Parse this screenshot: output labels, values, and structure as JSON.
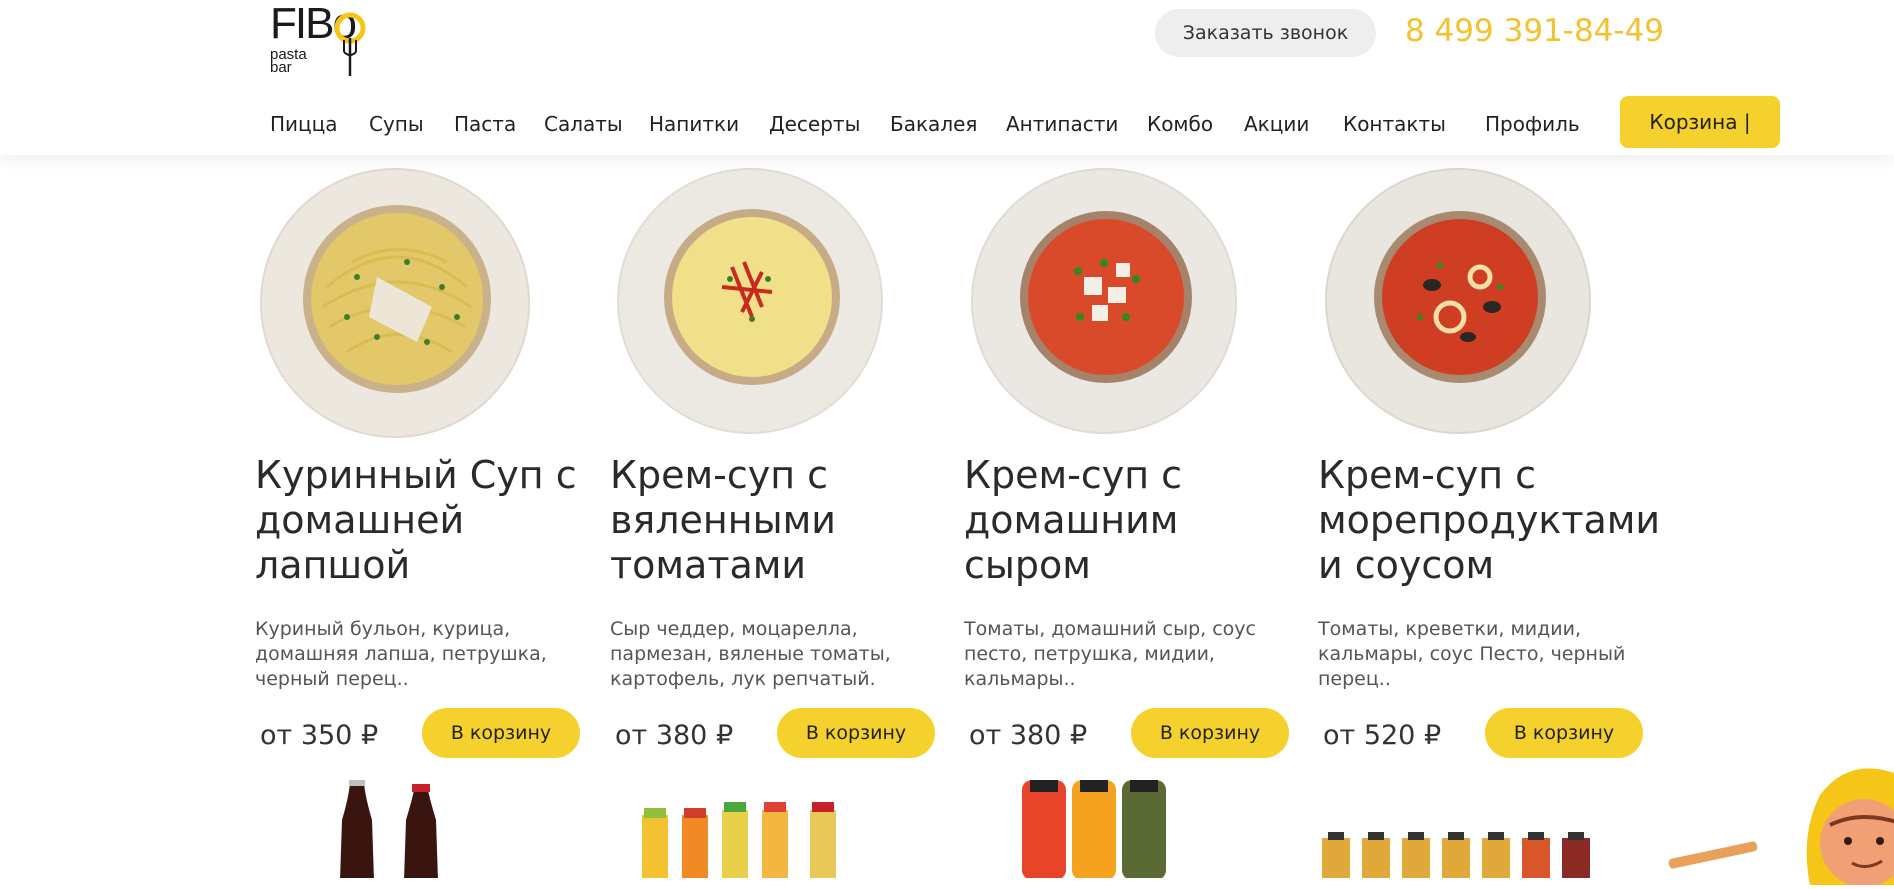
{
  "brand": {
    "logo_main": "FIBo",
    "logo_sub_1": "pasta",
    "logo_sub_2": "bar",
    "accent_color": "#f5d12d",
    "phone_color": "#f2c230"
  },
  "header": {
    "callback_label": "Заказать звонок",
    "phone": "8 499 391-84-49"
  },
  "nav": {
    "items": [
      "Пицца",
      "Супы",
      "Паста",
      "Салаты",
      "Напитки",
      "Десерты",
      "Бакалея",
      "Антипасти",
      "Комбо",
      "Акции",
      "Контакты",
      "Профиль"
    ],
    "cart_label": "Корзина |"
  },
  "products": [
    {
      "title": "Куринный Суп с домашней лапшой",
      "description": "Куриный бульон, курица, домашняя лапша, петрушка, черный перец..",
      "price": "от 350 ₽",
      "button": "В корзину",
      "image": "chicken-noodle-soup-plate"
    },
    {
      "title": "Крем-суп с вяленными томатами",
      "description": "Сыр чеддер, моцарелла, пармезан, вяленые томаты, картофель, лук репчатый.",
      "price": "от 380 ₽",
      "button": "В корзину",
      "image": "cream-soup-sundried-tomato-plate"
    },
    {
      "title": "Крем-суп с домашним сыром",
      "description": "Томаты, домашний сыр, соус песто, петрушка, мидии, кальмары..",
      "price": "от 380 ₽",
      "button": "В корзину",
      "image": "tomato-cheese-soup-plate"
    },
    {
      "title": "Крем-суп с морепродуктами и соусом",
      "description": "Томаты, креветки, мидии, кальмары, соус Песто, черный перец..",
      "price": "от 520 ₽",
      "button": "В корзину",
      "image": "seafood-soup-plate"
    }
  ],
  "drinks_row": [
    "cola-bottles-image",
    "bio-juice-bottles-image",
    "fresh-juice-bottles-image",
    "lemonade-bottles-image"
  ],
  "mascot": "chef-mascot-image"
}
